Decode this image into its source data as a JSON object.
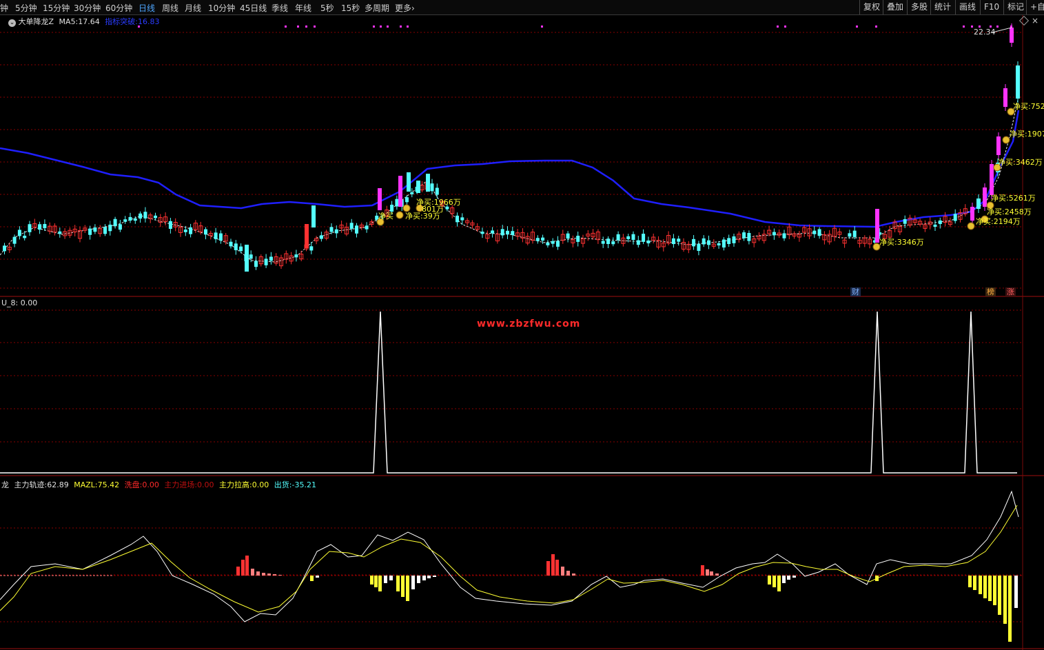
{
  "toolbar": {
    "periods": [
      "5分钟",
      "15分钟",
      "30分钟",
      "60分钟",
      "日线",
      "周线",
      "月线",
      "10分钟",
      "45日线",
      "季线",
      "年线",
      "5秒",
      "15秒",
      "多周期",
      "更多"
    ],
    "active_period": "日线",
    "left_cut": "钟",
    "right_buttons": [
      "复权",
      "叠加",
      "多股",
      "统计",
      "画线",
      "F10",
      "标记",
      "+自"
    ]
  },
  "main_header": {
    "indicator_name": "大单降龙Z",
    "ma5_label": "MA5:",
    "ma5_value": "17.64",
    "blue_label": "指标突破:",
    "blue_value": "16.83"
  },
  "price_high_label": "22.34",
  "net_buy_labels": [
    "净买:3346万",
    "净买:2194万",
    "净买:2458万",
    "净买:5261万",
    "净买:3462万",
    "净买:1907",
    "净买:752",
    "净买",
    "净买:1966万",
    "净买:39万",
    "801万"
  ],
  "event_flags": {
    "cai": "财",
    "bang": "榜",
    "zhang": "涨"
  },
  "panel2": {
    "label": "U_8:",
    "value": "0.00"
  },
  "watermark": "www.zbzfwu.com",
  "panel3": {
    "prefix": "龙",
    "main_label": "主力轨迹:",
    "main_value": "62.89",
    "mazl_label": "MAZL:",
    "mazl_value": "75.42",
    "xipan_label": "洗盘:",
    "xipan_value": "0.00",
    "jinchang_label": "主力进场:",
    "jinchang_value": "0.00",
    "lagao_label": "主力拉高:",
    "lagao_value": "0.00",
    "chuhuo_label": "出货:",
    "chuhuo_value": "-35.21"
  },
  "colors": {
    "up": "#ff3232",
    "down": "#54ffff",
    "magenta": "#ff33ff",
    "ma_line": "#1f1fff",
    "grid": "#8a0000",
    "yellow": "#ffff33",
    "white": "#ffffff",
    "pink": "#ff7f7f"
  }
}
